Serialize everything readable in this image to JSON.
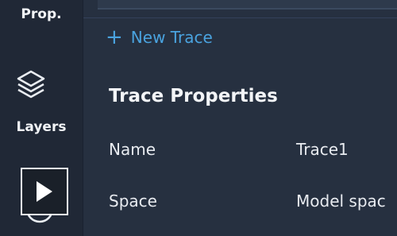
{
  "sidebar": {
    "tabs": [
      {
        "label": "Prop."
      },
      {
        "label": "Layers",
        "icon": "layers-icon"
      },
      {
        "label": "",
        "icon": "clock-icon"
      }
    ]
  },
  "overlay": {
    "icon": "play-icon"
  },
  "main": {
    "new_trace_label": "New Trace",
    "section_title": "Trace Properties",
    "properties": [
      {
        "key": "Name",
        "value": "Trace1"
      },
      {
        "key": "Space",
        "value": "Model spac"
      }
    ]
  },
  "colors": {
    "accent": "#4aa3df",
    "panel": "#263040",
    "sidebar": "#202836"
  }
}
